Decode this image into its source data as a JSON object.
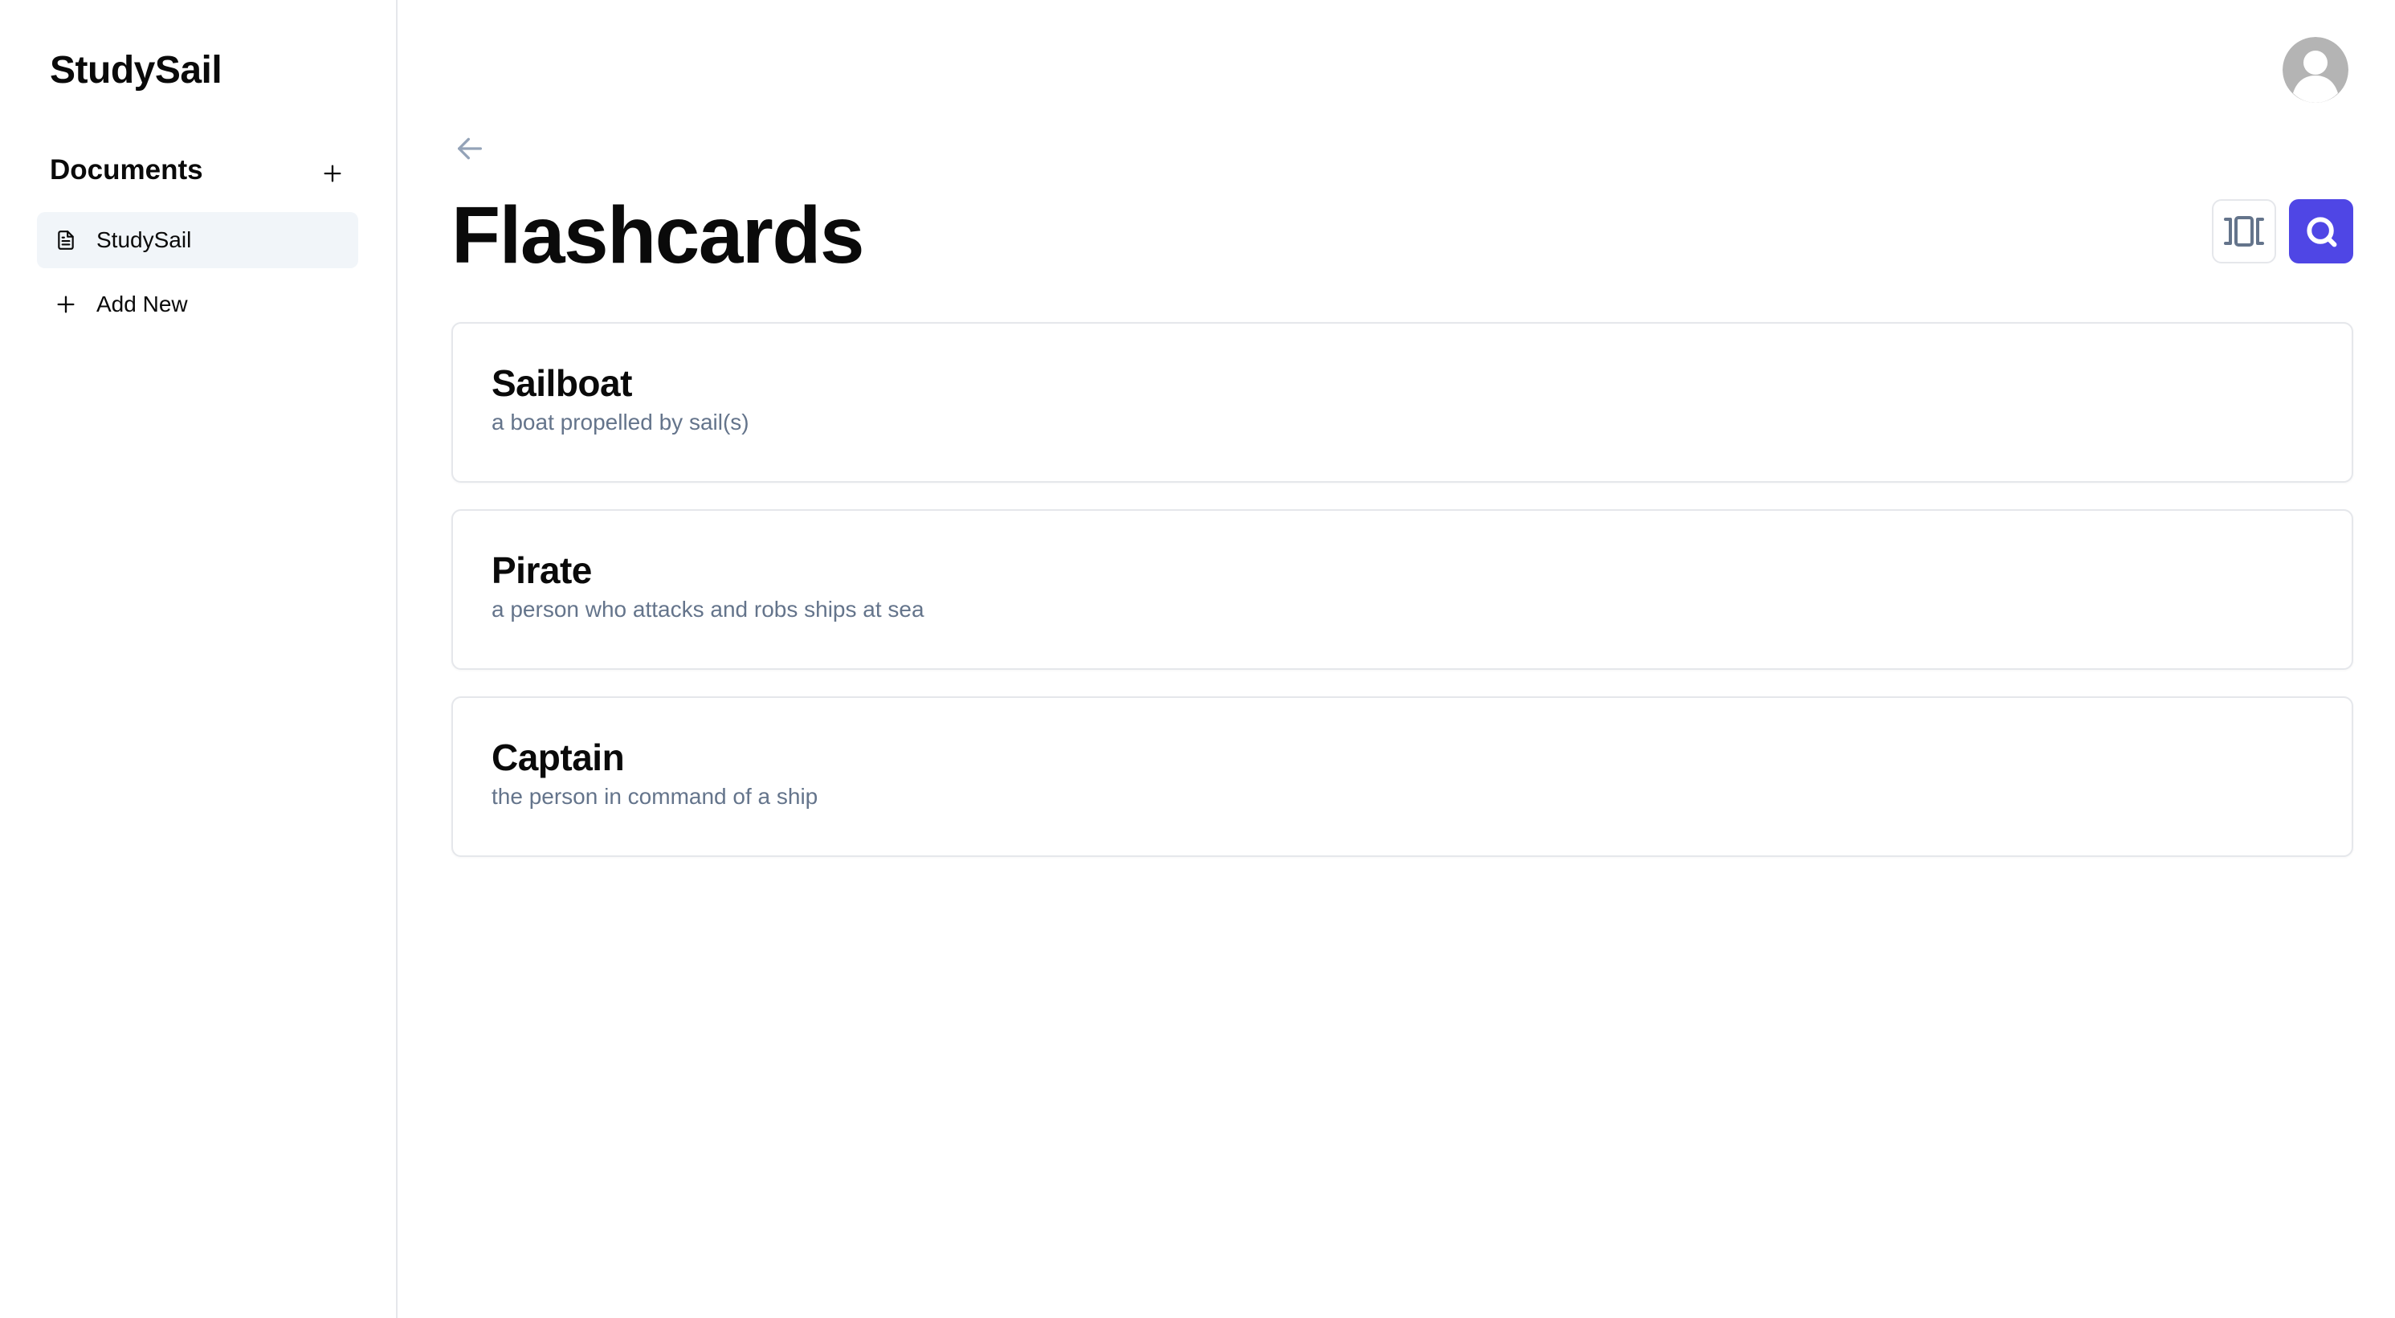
{
  "app": {
    "brand": "StudySail"
  },
  "sidebar": {
    "section_title": "Documents",
    "items": [
      {
        "label": "StudySail",
        "icon": "document-icon",
        "active": true
      },
      {
        "label": "Add New",
        "icon": "plus-icon",
        "active": false
      }
    ]
  },
  "main": {
    "title": "Flashcards",
    "cards": [
      {
        "term": "Sailboat",
        "definition": "a boat propelled by sail(s)"
      },
      {
        "term": "Pirate",
        "definition": "a person who attacks and robs ships at sea"
      },
      {
        "term": "Captain",
        "definition": "the person in command of a ship"
      }
    ]
  },
  "colors": {
    "accent": "#4f46e5",
    "active_bg": "#f1f5f9",
    "border": "#e5e7eb",
    "muted_text": "#64748b",
    "icon_gray": "#94a3b8"
  }
}
